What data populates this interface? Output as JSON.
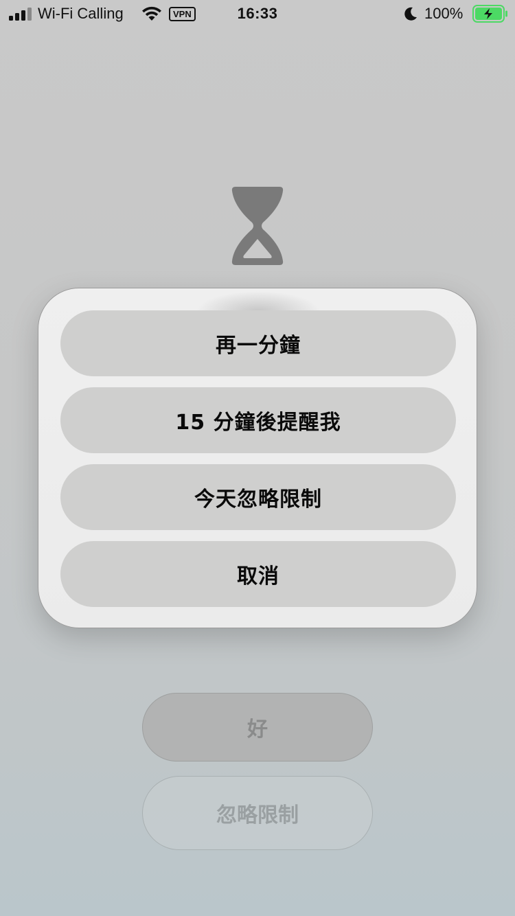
{
  "status_bar": {
    "carrier": "Wi-Fi Calling",
    "vpn": "VPN",
    "time": "16:33",
    "battery": "100%",
    "battery_charging": true,
    "signal_bars_active": 3,
    "signal_bars_total": 4
  },
  "icons": {
    "hourglass": "hourglass-icon",
    "wifi": "wifi-icon",
    "moon": "moon-icon",
    "battery": "battery-charging-icon"
  },
  "sheet": {
    "one_more_minute": "再一分鐘",
    "remind_15": "15 分鐘後提醒我",
    "ignore_today": "今天忽略限制",
    "cancel": "取消"
  },
  "footer": {
    "ok": "好",
    "ignore_limit": "忽略限制"
  },
  "colors": {
    "battery_green": "#4cd964",
    "sheet_background": "#ededed",
    "sheet_button": "#cfcfce",
    "hourglass": "#7a7a7a"
  }
}
